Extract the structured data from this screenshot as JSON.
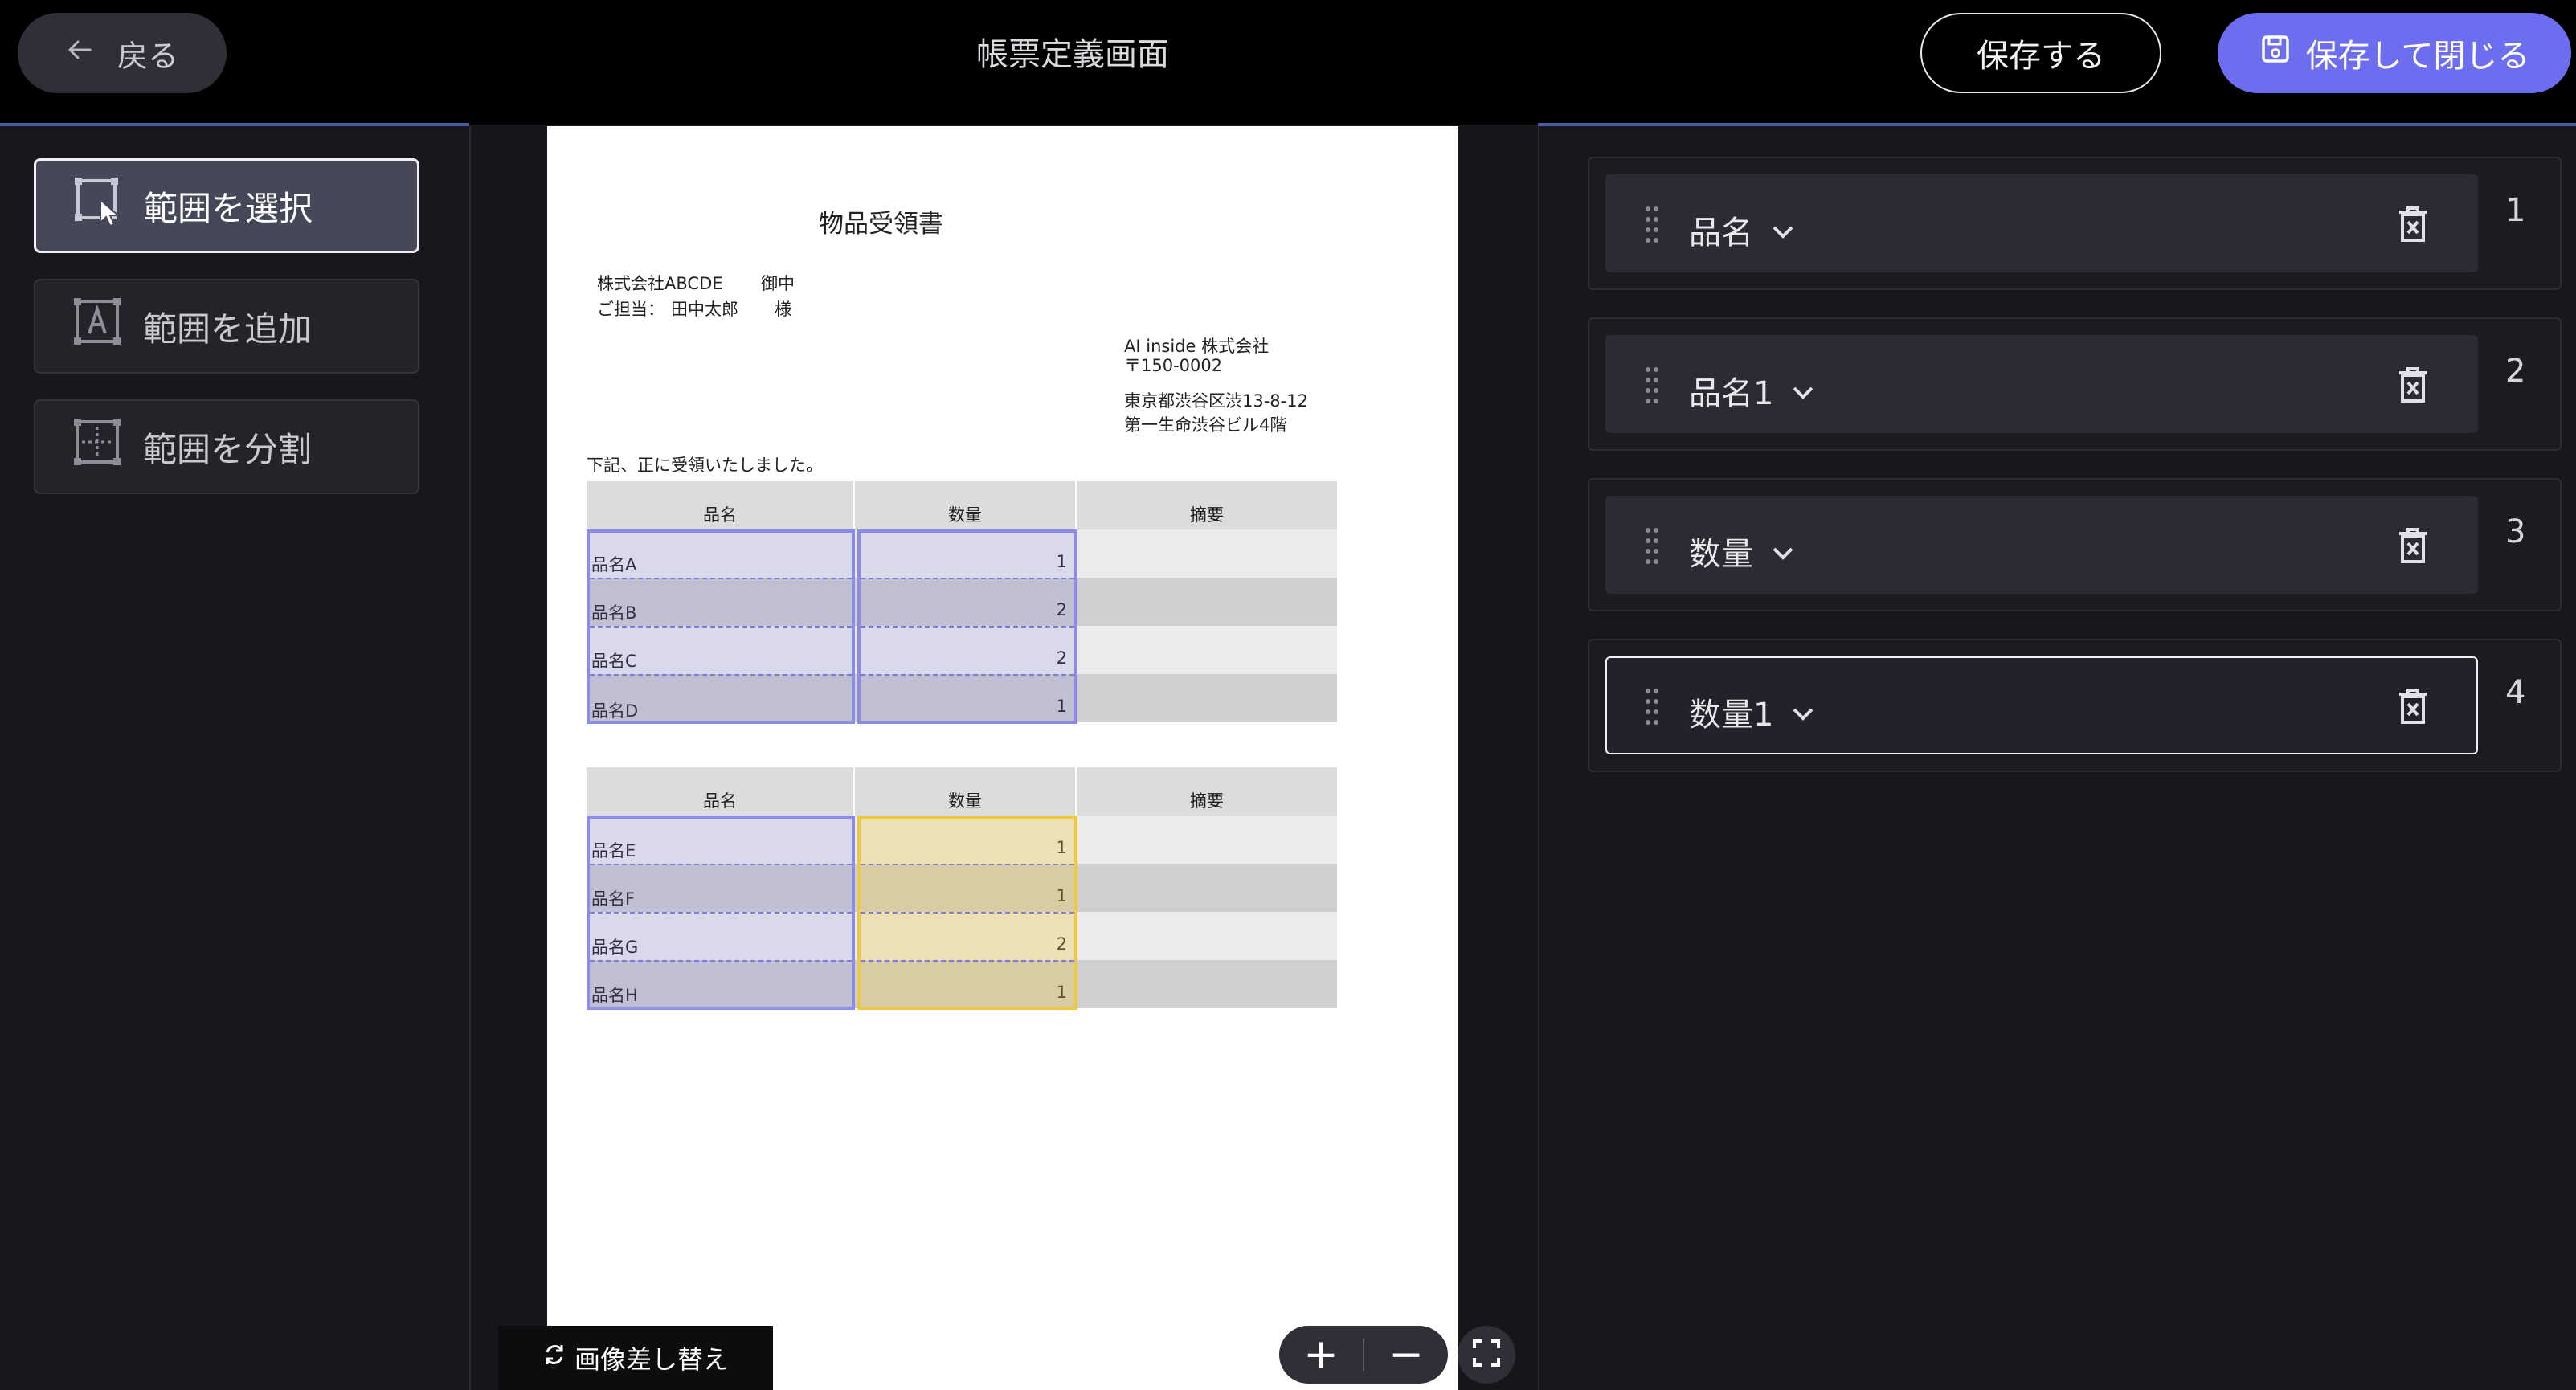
{
  "header": {
    "back_label": "戻る",
    "title": "帳票定義画面",
    "save_label": "保存する",
    "save_close_label": "保存して閉じる"
  },
  "tools": [
    {
      "label": "範囲を選択",
      "icon": "select-range-icon",
      "active": true
    },
    {
      "label": "範囲を追加",
      "icon": "add-range-icon",
      "active": false
    },
    {
      "label": "範囲を分割",
      "icon": "split-range-icon",
      "active": false
    }
  ],
  "document": {
    "title": "物品受領書",
    "recipient_company": "株式会社ABCDE",
    "recipient_honorific": "御中",
    "contact_label": "ご担当：",
    "contact_name": "田中太郎",
    "contact_honorific": "様",
    "sender_company": "AI inside 株式会社",
    "sender_postal": "〒150-0002",
    "sender_address1": "東京都渋谷区渋13-8-12",
    "sender_address2": "第一生命渋谷ビル4階",
    "intro": "下記、正に受領いたしました。",
    "tables": [
      {
        "headers": [
          "品名",
          "数量",
          "摘要"
        ],
        "rows": [
          [
            "品名A",
            "1",
            ""
          ],
          [
            "品名B",
            "2",
            ""
          ],
          [
            "品名C",
            "2",
            ""
          ],
          [
            "品名D",
            "1",
            ""
          ]
        ]
      },
      {
        "headers": [
          "品名",
          "数量",
          "摘要"
        ],
        "rows": [
          [
            "品名E",
            "1",
            ""
          ],
          [
            "品名F",
            "1",
            ""
          ],
          [
            "品名G",
            "2",
            ""
          ],
          [
            "品名H",
            "1",
            ""
          ]
        ]
      }
    ]
  },
  "bottom": {
    "replace_image_label": "画像差し替え",
    "zoom_in": "+",
    "zoom_out": "−"
  },
  "fields": [
    {
      "name": "品名",
      "index": "1",
      "active": false
    },
    {
      "name": "品名1",
      "index": "2",
      "active": false
    },
    {
      "name": "数量",
      "index": "3",
      "active": false
    },
    {
      "name": "数量1",
      "index": "4",
      "active": true
    }
  ],
  "colors": {
    "accent": "#6d6df0",
    "selection_blue": "#8c8ce6",
    "selection_yellow": "#f0c840"
  }
}
